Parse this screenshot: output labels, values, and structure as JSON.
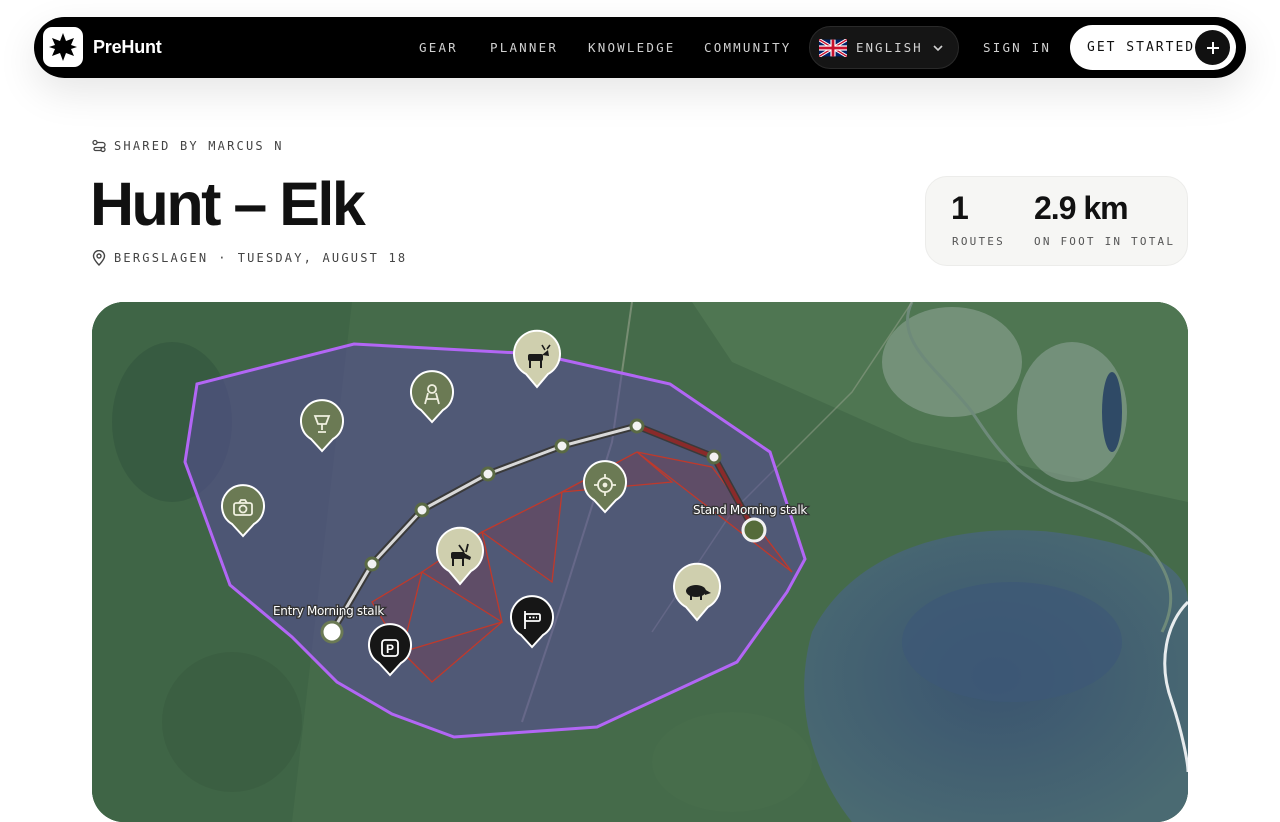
{
  "nav": {
    "brand": "PreHunt",
    "links": [
      "GEAR",
      "PLANNER",
      "KNOWLEDGE",
      "COMMUNITY"
    ],
    "language": "ENGLISH",
    "sign_in": "SIGN IN",
    "get_started": "GET STARTED"
  },
  "hunt": {
    "shared_by": "SHARED BY MARCUS N",
    "title": "Hunt – Elk",
    "location": "BERGSLAGEN",
    "separator": "·",
    "date": "TUESDAY, AUGUST 18"
  },
  "stats": {
    "routes_value": "1",
    "routes_label": "ROUTES",
    "distance_value": "2.9 km",
    "distance_label": "ON FOOT IN TOTAL"
  },
  "map": {
    "labels": {
      "stand": "Stand Morning stalk",
      "entry": "Entry Morning stalk"
    },
    "markers": [
      "elk",
      "tower-stand",
      "trophy",
      "camera",
      "target",
      "wild-boar",
      "moose",
      "parking",
      "rest-stop"
    ],
    "colors": {
      "zone_border": "#a855f7",
      "route": "#d9d9d9",
      "trail": "#c0392b",
      "marker_light": "#cfcfae",
      "marker_green": "#6b7a54",
      "marker_dark": "#161616"
    }
  }
}
